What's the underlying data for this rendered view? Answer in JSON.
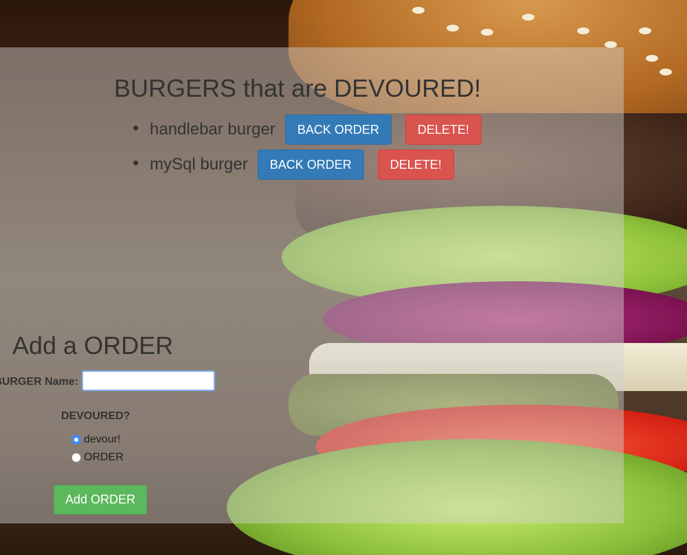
{
  "devoured": {
    "title": "BURGERS that are DEVOURED!",
    "items": [
      {
        "name": "handlebar burger",
        "back_label": "BACK ORDER",
        "delete_label": "DELETE!"
      },
      {
        "name": "mySql burger",
        "back_label": "BACK ORDER",
        "delete_label": "DELETE!"
      }
    ]
  },
  "form": {
    "title": "Add a ORDER",
    "name_label": "BURGER Name:",
    "name_value": "",
    "devoured_question": "DEVOURED?",
    "options": [
      {
        "label": "devour!",
        "checked": true
      },
      {
        "label": "ORDER",
        "checked": false
      }
    ],
    "submit_label": "Add ORDER"
  },
  "colors": {
    "back_button": "#337ab7",
    "delete_button": "#d9534f",
    "add_button": "#5cb85c"
  }
}
